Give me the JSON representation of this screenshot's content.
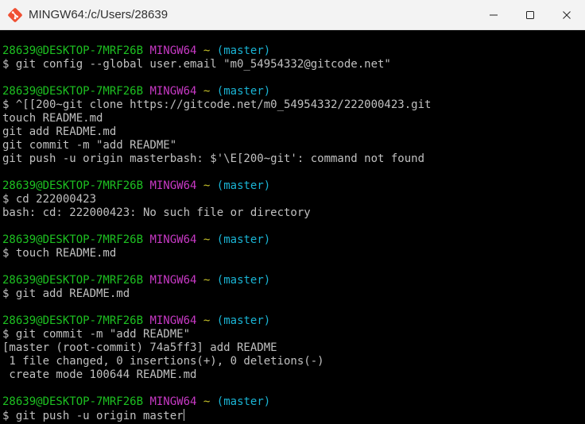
{
  "window": {
    "title": "MINGW64:/c/Users/28639",
    "icon": "git-bash-icon",
    "controls": [
      "minimize-icon",
      "maximize-icon",
      "close-icon"
    ]
  },
  "colors": {
    "user": "#1dc121",
    "host": "#c839c5",
    "path": "#c7c329",
    "branch": "#1ab4d4",
    "text": "#c0c0c0",
    "background": "#000000"
  },
  "prompt": {
    "user_host": "28639@DESKTOP-7MRF26B",
    "system": "MINGW64",
    "path": "~",
    "branch": "(master)"
  },
  "blocks": [
    {
      "command": "$ git config --global user.email \"m0_54954332@gitcode.net\"",
      "output": []
    },
    {
      "command": "$ ^[[200~git clone https://gitcode.net/m0_54954332/222000423.git",
      "output": [
        "touch README.md",
        "git add README.md",
        "git commit -m \"add README\"",
        "git push -u origin masterbash: $'\\E[200~git': command not found"
      ]
    },
    {
      "command": "$ cd 222000423",
      "output": [
        "bash: cd: 222000423: No such file or directory"
      ]
    },
    {
      "command": "$ touch README.md",
      "output": []
    },
    {
      "command": "$ git add README.md",
      "output": []
    },
    {
      "command": "$ git commit -m \"add README\"",
      "output": [
        "[master (root-commit) 74a5ff3] add README",
        " 1 file changed, 0 insertions(+), 0 deletions(-)",
        " create mode 100644 README.md"
      ]
    }
  ],
  "current_input": "$ git push -u origin master"
}
